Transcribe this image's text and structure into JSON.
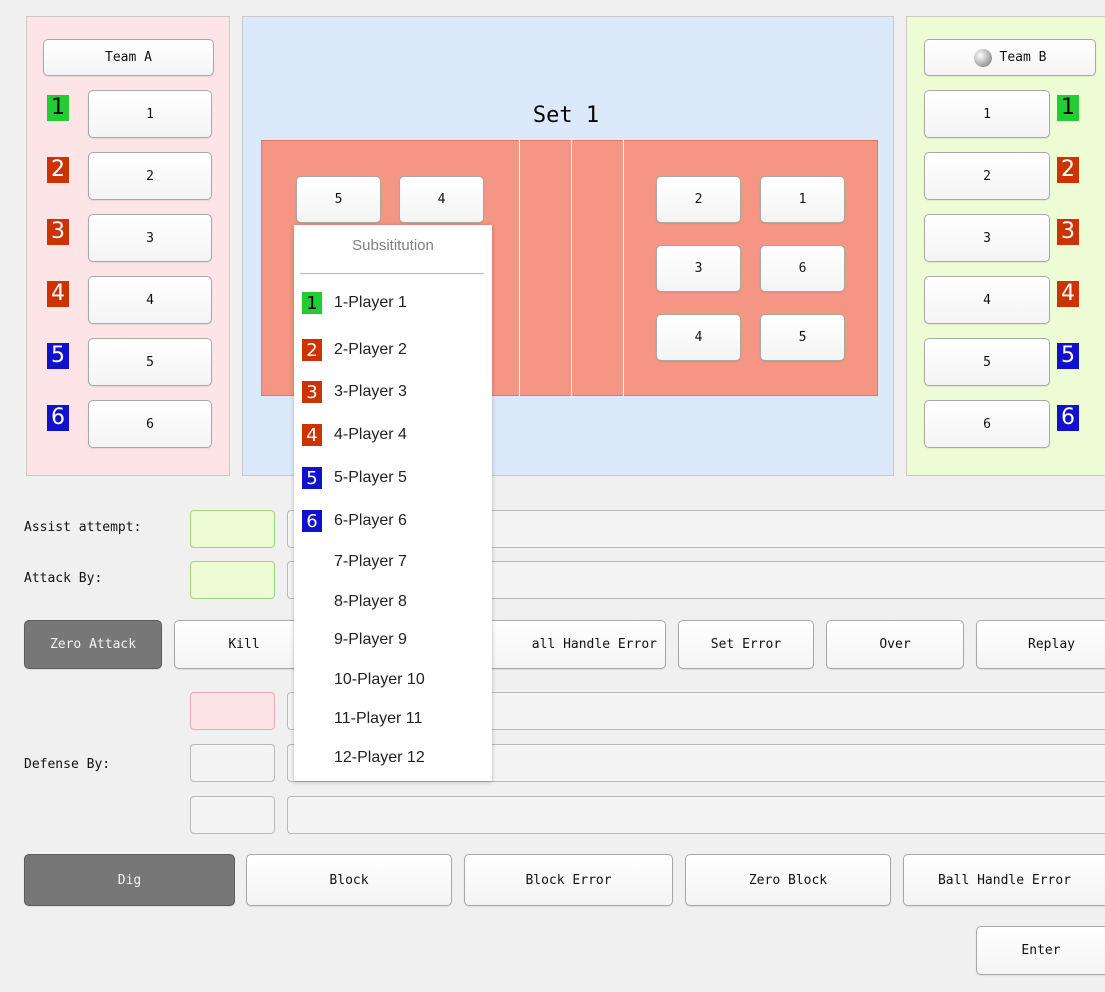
{
  "colors": {
    "green": "#22cc33",
    "red": "#cc3300",
    "blue": "#1111cc",
    "team_a_bg": "#fde4e7",
    "team_b_bg": "#eefcd6",
    "court_bg": "#dce9fa",
    "court_red": "#f59583"
  },
  "team_a": {
    "name": "Team A",
    "players": [
      {
        "badge": "1",
        "label": "1",
        "color": "green"
      },
      {
        "badge": "2",
        "label": "2",
        "color": "red"
      },
      {
        "badge": "3",
        "label": "3",
        "color": "red"
      },
      {
        "badge": "4",
        "label": "4",
        "color": "red"
      },
      {
        "badge": "5",
        "label": "5",
        "color": "blue"
      },
      {
        "badge": "6",
        "label": "6",
        "color": "blue"
      }
    ]
  },
  "team_b": {
    "name": "Team B",
    "serving_icon": "ball-icon",
    "players": [
      {
        "badge": "1",
        "label": "1",
        "color": "green"
      },
      {
        "badge": "2",
        "label": "2",
        "color": "red"
      },
      {
        "badge": "3",
        "label": "3",
        "color": "red"
      },
      {
        "badge": "4",
        "label": "4",
        "color": "red"
      },
      {
        "badge": "5",
        "label": "5",
        "color": "blue"
      },
      {
        "badge": "6",
        "label": "6",
        "color": "blue"
      }
    ]
  },
  "court": {
    "title": "Set 1",
    "left_positions": [
      "5",
      "4"
    ],
    "right_positions": [
      "2",
      "1",
      "3",
      "6",
      "4",
      "5"
    ]
  },
  "assist": {
    "label": "Assist attempt:"
  },
  "attack": {
    "label": "Attack By:"
  },
  "attack_buttons": [
    "Zero Attack",
    "Kill",
    "all Handle Error",
    "Set Error",
    "Over",
    "Replay"
  ],
  "defense": {
    "label": "Defense By:"
  },
  "defense_buttons": [
    "Dig",
    "Block",
    "Block Error",
    "Zero Block",
    "Ball Handle Error"
  ],
  "enter_label": "Enter",
  "popup": {
    "title": "Subsititution",
    "items": [
      {
        "badge": "1",
        "color": "green",
        "text": "1-Player 1"
      },
      {
        "badge": "2",
        "color": "red",
        "text": "2-Player 2"
      },
      {
        "badge": "3",
        "color": "red",
        "text": "3-Player 3"
      },
      {
        "badge": "4",
        "color": "red",
        "text": "4-Player 4"
      },
      {
        "badge": "5",
        "color": "blue",
        "text": "5-Player 5"
      },
      {
        "badge": "6",
        "color": "blue",
        "text": "6-Player 6"
      },
      {
        "badge": "",
        "color": "",
        "text": "7-Player 7"
      },
      {
        "badge": "",
        "color": "",
        "text": "8-Player 8"
      },
      {
        "badge": "",
        "color": "",
        "text": "9-Player 9"
      },
      {
        "badge": "",
        "color": "",
        "text": "10-Player 10"
      },
      {
        "badge": "",
        "color": "",
        "text": "11-Player 11"
      },
      {
        "badge": "",
        "color": "",
        "text": "12-Player 12"
      }
    ]
  }
}
